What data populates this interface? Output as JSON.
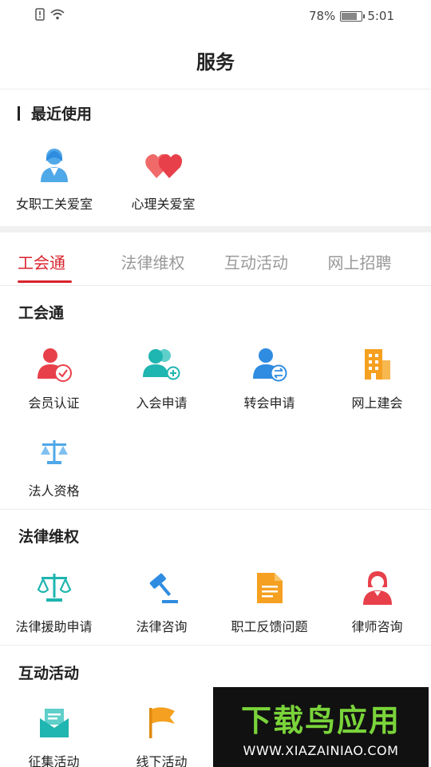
{
  "status_bar": {
    "battery": "78%",
    "time": "5:01"
  },
  "header": {
    "title": "服务"
  },
  "recent": {
    "title": "最近使用",
    "items": [
      {
        "label": "女职工关爱室",
        "icon": "female-worker-icon"
      },
      {
        "label": "心理关爱室",
        "icon": "hearts-icon"
      }
    ]
  },
  "tabs": [
    {
      "label": "工会通",
      "active": true
    },
    {
      "label": "法律维权",
      "active": false
    },
    {
      "label": "互动活动",
      "active": false
    },
    {
      "label": "网上招聘",
      "active": false
    }
  ],
  "sections": [
    {
      "title": "工会通",
      "items": [
        {
          "label": "会员认证",
          "icon": "member-verify-icon"
        },
        {
          "label": "入会申请",
          "icon": "join-union-icon"
        },
        {
          "label": "转会申请",
          "icon": "transfer-icon"
        },
        {
          "label": "网上建会",
          "icon": "building-icon"
        },
        {
          "label": "法人资格",
          "icon": "scales-icon"
        }
      ]
    },
    {
      "title": "法律维权",
      "items": [
        {
          "label": "法律援助申请",
          "icon": "legal-aid-icon"
        },
        {
          "label": "法律咨询",
          "icon": "gavel-icon"
        },
        {
          "label": "职工反馈问题",
          "icon": "document-icon"
        },
        {
          "label": "律师咨询",
          "icon": "lawyer-icon"
        }
      ]
    },
    {
      "title": "互动活动",
      "items": [
        {
          "label": "征集活动",
          "icon": "envelope-icon"
        },
        {
          "label": "线下活动",
          "icon": "flag-icon"
        }
      ]
    }
  ],
  "watermark": {
    "title": "下载鸟应用",
    "url": "WWW.XIAZAINIAO.COM"
  },
  "colors": {
    "accent": "#d9232d",
    "teal": "#1fb5b0",
    "blue": "#2f8ce0",
    "orange": "#f5a020",
    "red": "#e8404a"
  }
}
